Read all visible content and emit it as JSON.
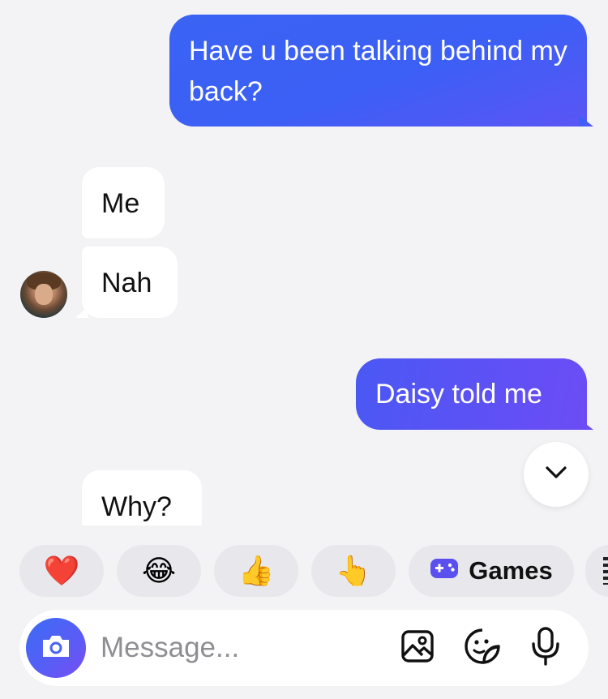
{
  "messages": [
    {
      "direction": "sent",
      "text": "Have u been talking behind my back?"
    },
    {
      "direction": "received",
      "text": "Me"
    },
    {
      "direction": "received",
      "text": "Nah"
    },
    {
      "direction": "sent",
      "text": "Daisy told me"
    },
    {
      "direction": "received",
      "text": "Why?"
    }
  ],
  "quick_reactions": [
    {
      "emoji": "❤️",
      "icon": "heart-emoji"
    },
    {
      "emoji": "😂",
      "icon": "tears-of-joy-emoji"
    },
    {
      "emoji": "👍",
      "icon": "thumbs-up-emoji"
    },
    {
      "emoji": "👆",
      "icon": "pointing-up-emoji"
    },
    {
      "emoji": "",
      "icon": "gamepad-icon",
      "label": "Games"
    }
  ],
  "composer": {
    "placeholder": "Message..."
  },
  "colors": {
    "sent_bubble": "#3c5ff5",
    "received_bubble": "#ffffff",
    "background": "#f3f3f5",
    "accent_purple": "#6c4cf5"
  }
}
